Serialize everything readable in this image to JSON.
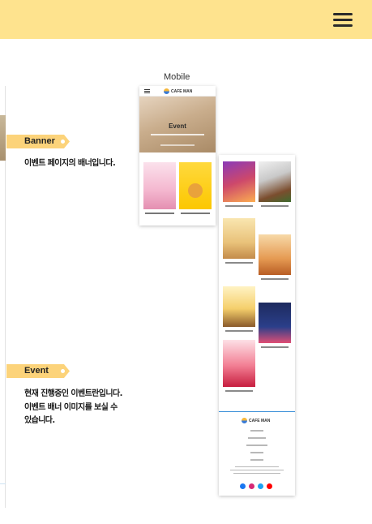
{
  "header": {
    "menu_icon": "hamburger-menu-icon",
    "bg_color": "#fee38e"
  },
  "preview": {
    "mobile_label": "Mobile"
  },
  "sections": {
    "banner": {
      "tag": "Banner",
      "description": "이벤트 페이지의 배너입니다."
    },
    "event": {
      "tag": "Event",
      "description_lines": [
        "현재 진행중인 이벤트란입니다.",
        "이벤트 배너 이미지를 보실 수",
        "있습니다."
      ]
    }
  },
  "mockup": {
    "logo_text": "CAFE MAN",
    "hero_title": "Event"
  },
  "colors": {
    "tag": "#fcd37a",
    "footer_accent": "#3a8fd8"
  }
}
